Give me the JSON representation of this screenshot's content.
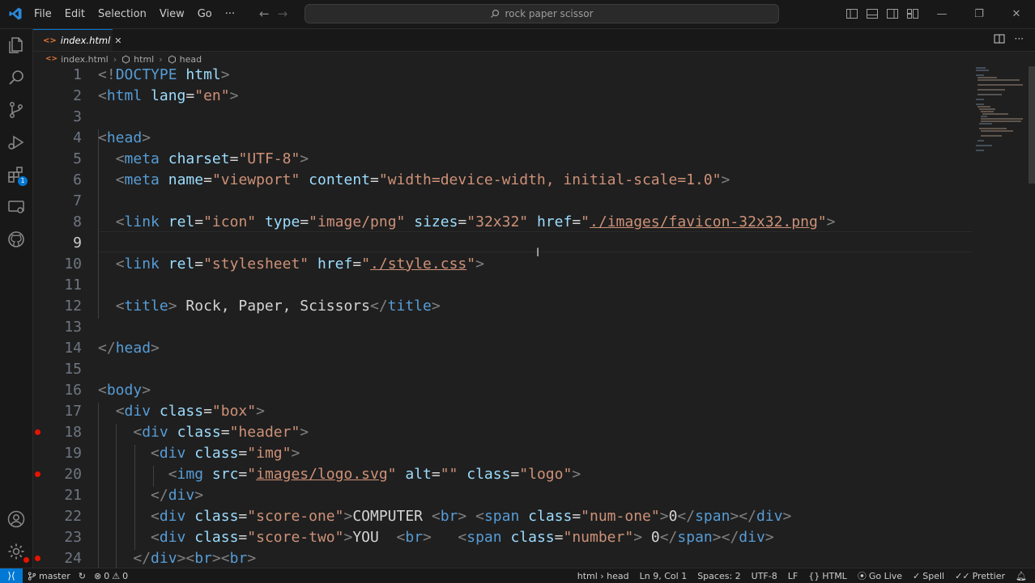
{
  "menu": [
    "File",
    "Edit",
    "Selection",
    "View",
    "Go",
    "···"
  ],
  "command_center": {
    "text": "rock paper scissor"
  },
  "tab": {
    "filename": "index.html",
    "close": "✕"
  },
  "breadcrumb": [
    "index.html",
    "html",
    "head"
  ],
  "colors": {
    "accent": "#0078d4",
    "breakpoint": "#e51400",
    "tag": "#569cd6",
    "attribute": "#9cdcfe",
    "string": "#ce9178",
    "bracket": "#808080"
  },
  "editor": {
    "active_line": "9",
    "lines": [
      {
        "num": "1",
        "tokens": [
          {
            "c": "t",
            "v": "<!"
          },
          {
            "c": "n",
            "v": "DOCTYPE"
          },
          {
            "c": "x",
            "v": " "
          },
          {
            "c": "a",
            "v": "html"
          },
          {
            "c": "t",
            "v": ">"
          }
        ]
      },
      {
        "num": "2",
        "tokens": [
          {
            "c": "t",
            "v": "<"
          },
          {
            "c": "n",
            "v": "html"
          },
          {
            "c": "x",
            "v": " "
          },
          {
            "c": "a",
            "v": "lang"
          },
          {
            "c": "x",
            "v": "="
          },
          {
            "c": "s",
            "v": "\"en\""
          },
          {
            "c": "t",
            "v": ">"
          }
        ]
      },
      {
        "num": "3",
        "tokens": []
      },
      {
        "num": "4",
        "tokens": [
          {
            "c": "t",
            "v": "<"
          },
          {
            "c": "n",
            "v": "head"
          },
          {
            "c": "t",
            "v": ">"
          }
        ]
      },
      {
        "num": "5",
        "tokens": [
          {
            "c": "x",
            "v": "  "
          },
          {
            "c": "t",
            "v": "<"
          },
          {
            "c": "n",
            "v": "meta"
          },
          {
            "c": "x",
            "v": " "
          },
          {
            "c": "a",
            "v": "charset"
          },
          {
            "c": "x",
            "v": "="
          },
          {
            "c": "s",
            "v": "\"UTF-8\""
          },
          {
            "c": "t",
            "v": ">"
          }
        ]
      },
      {
        "num": "6",
        "tokens": [
          {
            "c": "x",
            "v": "  "
          },
          {
            "c": "t",
            "v": "<"
          },
          {
            "c": "n",
            "v": "meta"
          },
          {
            "c": "x",
            "v": " "
          },
          {
            "c": "a",
            "v": "name"
          },
          {
            "c": "x",
            "v": "="
          },
          {
            "c": "s",
            "v": "\"viewport\""
          },
          {
            "c": "x",
            "v": " "
          },
          {
            "c": "a",
            "v": "content"
          },
          {
            "c": "x",
            "v": "="
          },
          {
            "c": "s",
            "v": "\"width=device-width, initial-scale=1.0\""
          },
          {
            "c": "t",
            "v": ">"
          }
        ]
      },
      {
        "num": "7",
        "tokens": []
      },
      {
        "num": "8",
        "tokens": [
          {
            "c": "x",
            "v": "  "
          },
          {
            "c": "t",
            "v": "<"
          },
          {
            "c": "n",
            "v": "link"
          },
          {
            "c": "x",
            "v": " "
          },
          {
            "c": "a",
            "v": "rel"
          },
          {
            "c": "x",
            "v": "="
          },
          {
            "c": "s",
            "v": "\"icon\""
          },
          {
            "c": "x",
            "v": " "
          },
          {
            "c": "a",
            "v": "type"
          },
          {
            "c": "x",
            "v": "="
          },
          {
            "c": "s",
            "v": "\"image/png\""
          },
          {
            "c": "x",
            "v": " "
          },
          {
            "c": "a",
            "v": "sizes"
          },
          {
            "c": "x",
            "v": "="
          },
          {
            "c": "s",
            "v": "\"32x32\""
          },
          {
            "c": "x",
            "v": " "
          },
          {
            "c": "a",
            "v": "href"
          },
          {
            "c": "x",
            "v": "="
          },
          {
            "c": "s",
            "v": "\""
          },
          {
            "c": "u",
            "v": "./images/favicon-32x32.png"
          },
          {
            "c": "s",
            "v": "\""
          },
          {
            "c": "t",
            "v": ">"
          }
        ]
      },
      {
        "num": "9",
        "tokens": []
      },
      {
        "num": "10",
        "tokens": [
          {
            "c": "x",
            "v": "  "
          },
          {
            "c": "t",
            "v": "<"
          },
          {
            "c": "n",
            "v": "link"
          },
          {
            "c": "x",
            "v": " "
          },
          {
            "c": "a",
            "v": "rel"
          },
          {
            "c": "x",
            "v": "="
          },
          {
            "c": "s",
            "v": "\"stylesheet\""
          },
          {
            "c": "x",
            "v": " "
          },
          {
            "c": "a",
            "v": "href"
          },
          {
            "c": "x",
            "v": "="
          },
          {
            "c": "s",
            "v": "\""
          },
          {
            "c": "u",
            "v": "./style.css"
          },
          {
            "c": "s",
            "v": "\""
          },
          {
            "c": "t",
            "v": ">"
          }
        ]
      },
      {
        "num": "11",
        "tokens": []
      },
      {
        "num": "12",
        "tokens": [
          {
            "c": "x",
            "v": "  "
          },
          {
            "c": "t",
            "v": "<"
          },
          {
            "c": "n",
            "v": "title"
          },
          {
            "c": "t",
            "v": ">"
          },
          {
            "c": "x",
            "v": " Rock, Paper, Scissors"
          },
          {
            "c": "t",
            "v": "</"
          },
          {
            "c": "n",
            "v": "title"
          },
          {
            "c": "t",
            "v": ">"
          }
        ]
      },
      {
        "num": "13",
        "tokens": []
      },
      {
        "num": "14",
        "tokens": [
          {
            "c": "t",
            "v": "</"
          },
          {
            "c": "n",
            "v": "head"
          },
          {
            "c": "t",
            "v": ">"
          }
        ]
      },
      {
        "num": "15",
        "tokens": []
      },
      {
        "num": "16",
        "tokens": [
          {
            "c": "t",
            "v": "<"
          },
          {
            "c": "n",
            "v": "body"
          },
          {
            "c": "t",
            "v": ">"
          }
        ]
      },
      {
        "num": "17",
        "tokens": [
          {
            "c": "x",
            "v": "  "
          },
          {
            "c": "t",
            "v": "<"
          },
          {
            "c": "n",
            "v": "div"
          },
          {
            "c": "x",
            "v": " "
          },
          {
            "c": "a",
            "v": "class"
          },
          {
            "c": "x",
            "v": "="
          },
          {
            "c": "s",
            "v": "\"box\""
          },
          {
            "c": "t",
            "v": ">"
          }
        ]
      },
      {
        "num": "18",
        "bp": true,
        "tokens": [
          {
            "c": "x",
            "v": "    "
          },
          {
            "c": "t",
            "v": "<"
          },
          {
            "c": "n",
            "v": "div"
          },
          {
            "c": "x",
            "v": " "
          },
          {
            "c": "a",
            "v": "class"
          },
          {
            "c": "x",
            "v": "="
          },
          {
            "c": "s",
            "v": "\"header\""
          },
          {
            "c": "t",
            "v": ">"
          }
        ]
      },
      {
        "num": "19",
        "tokens": [
          {
            "c": "x",
            "v": "      "
          },
          {
            "c": "t",
            "v": "<"
          },
          {
            "c": "n",
            "v": "div"
          },
          {
            "c": "x",
            "v": " "
          },
          {
            "c": "a",
            "v": "class"
          },
          {
            "c": "x",
            "v": "="
          },
          {
            "c": "s",
            "v": "\"img\""
          },
          {
            "c": "t",
            "v": ">"
          }
        ]
      },
      {
        "num": "20",
        "bp": true,
        "tokens": [
          {
            "c": "x",
            "v": "        "
          },
          {
            "c": "t",
            "v": "<"
          },
          {
            "c": "n",
            "v": "img"
          },
          {
            "c": "x",
            "v": " "
          },
          {
            "c": "a",
            "v": "src"
          },
          {
            "c": "x",
            "v": "="
          },
          {
            "c": "s",
            "v": "\""
          },
          {
            "c": "u",
            "v": "images/logo.svg"
          },
          {
            "c": "s",
            "v": "\""
          },
          {
            "c": "x",
            "v": " "
          },
          {
            "c": "a",
            "v": "alt"
          },
          {
            "c": "x",
            "v": "="
          },
          {
            "c": "s",
            "v": "\"\""
          },
          {
            "c": "x",
            "v": " "
          },
          {
            "c": "a",
            "v": "class"
          },
          {
            "c": "x",
            "v": "="
          },
          {
            "c": "s",
            "v": "\"logo\""
          },
          {
            "c": "t",
            "v": ">"
          }
        ]
      },
      {
        "num": "21",
        "tokens": [
          {
            "c": "x",
            "v": "      "
          },
          {
            "c": "t",
            "v": "</"
          },
          {
            "c": "n",
            "v": "div"
          },
          {
            "c": "t",
            "v": ">"
          }
        ]
      },
      {
        "num": "22",
        "tokens": [
          {
            "c": "x",
            "v": "      "
          },
          {
            "c": "t",
            "v": "<"
          },
          {
            "c": "n",
            "v": "div"
          },
          {
            "c": "x",
            "v": " "
          },
          {
            "c": "a",
            "v": "class"
          },
          {
            "c": "x",
            "v": "="
          },
          {
            "c": "s",
            "v": "\"score-one\""
          },
          {
            "c": "t",
            "v": ">"
          },
          {
            "c": "x",
            "v": "COMPUTER "
          },
          {
            "c": "t",
            "v": "<"
          },
          {
            "c": "n",
            "v": "br"
          },
          {
            "c": "t",
            "v": ">"
          },
          {
            "c": "x",
            "v": " "
          },
          {
            "c": "t",
            "v": "<"
          },
          {
            "c": "n",
            "v": "span"
          },
          {
            "c": "x",
            "v": " "
          },
          {
            "c": "a",
            "v": "class"
          },
          {
            "c": "x",
            "v": "="
          },
          {
            "c": "s",
            "v": "\"num-one\""
          },
          {
            "c": "t",
            "v": ">"
          },
          {
            "c": "x",
            "v": "0"
          },
          {
            "c": "t",
            "v": "</"
          },
          {
            "c": "n",
            "v": "span"
          },
          {
            "c": "t",
            "v": "></"
          },
          {
            "c": "n",
            "v": "div"
          },
          {
            "c": "t",
            "v": ">"
          }
        ]
      },
      {
        "num": "23",
        "tokens": [
          {
            "c": "x",
            "v": "      "
          },
          {
            "c": "t",
            "v": "<"
          },
          {
            "c": "n",
            "v": "div"
          },
          {
            "c": "x",
            "v": " "
          },
          {
            "c": "a",
            "v": "class"
          },
          {
            "c": "x",
            "v": "="
          },
          {
            "c": "s",
            "v": "\"score-two\""
          },
          {
            "c": "t",
            "v": ">"
          },
          {
            "c": "x",
            "v": "YOU  "
          },
          {
            "c": "t",
            "v": "<"
          },
          {
            "c": "n",
            "v": "br"
          },
          {
            "c": "t",
            "v": ">"
          },
          {
            "c": "x",
            "v": "   "
          },
          {
            "c": "t",
            "v": "<"
          },
          {
            "c": "n",
            "v": "span"
          },
          {
            "c": "x",
            "v": " "
          },
          {
            "c": "a",
            "v": "class"
          },
          {
            "c": "x",
            "v": "="
          },
          {
            "c": "s",
            "v": "\"number\""
          },
          {
            "c": "t",
            "v": ">"
          },
          {
            "c": "x",
            "v": " 0"
          },
          {
            "c": "t",
            "v": "</"
          },
          {
            "c": "n",
            "v": "span"
          },
          {
            "c": "t",
            "v": "></"
          },
          {
            "c": "n",
            "v": "div"
          },
          {
            "c": "t",
            "v": ">"
          }
        ]
      },
      {
        "num": "24",
        "bp": true,
        "tokens": [
          {
            "c": "x",
            "v": "    "
          },
          {
            "c": "t",
            "v": "</"
          },
          {
            "c": "n",
            "v": "div"
          },
          {
            "c": "t",
            "v": "><"
          },
          {
            "c": "n",
            "v": "br"
          },
          {
            "c": "t",
            "v": "><"
          },
          {
            "c": "n",
            "v": "br"
          },
          {
            "c": "t",
            "v": ">"
          }
        ]
      }
    ]
  },
  "status": {
    "branch": "master",
    "errors": "0",
    "warnings": "0",
    "breadcrumb": "html › head",
    "position": "Ln 9, Col 1",
    "spaces": "Spaces: 2",
    "encoding": "UTF-8",
    "eol": "LF",
    "language": "HTML",
    "go_live": "Go Live",
    "spell": "Spell",
    "prettier": "Prettier"
  }
}
